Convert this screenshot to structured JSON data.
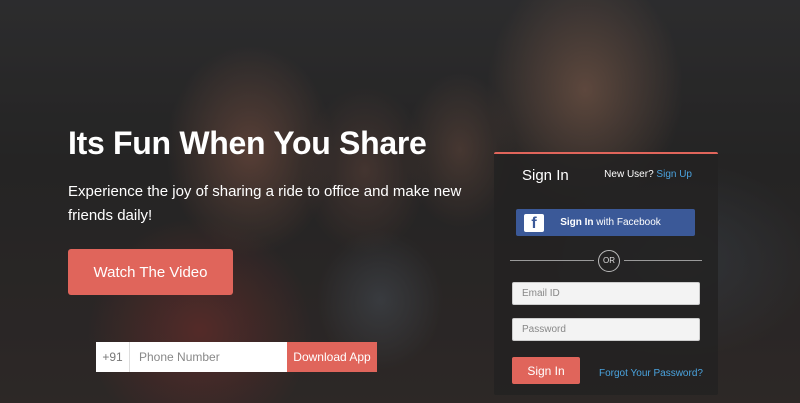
{
  "hero": {
    "title": "Its Fun When You Share",
    "subtitle": "Experience the joy of sharing a ride to office and make new friends daily!",
    "watch_label": "Watch The Video"
  },
  "download": {
    "country_code": "+91",
    "phone_placeholder": "Phone Number",
    "button_label": "Download App"
  },
  "signin": {
    "title": "Sign In",
    "new_user_text": "New User?",
    "signup_link": "Sign Up",
    "facebook_bold": "Sign In",
    "facebook_rest": " with Facebook",
    "facebook_icon": "facebook-icon",
    "or_text": "OR",
    "email_placeholder": "Email ID",
    "password_placeholder": "Password",
    "button_label": "Sign In",
    "forgot_link": "Forgot Your Password?"
  },
  "colors": {
    "accent": "#e0655b",
    "facebook": "#3b5998",
    "link": "#4aa3df"
  }
}
